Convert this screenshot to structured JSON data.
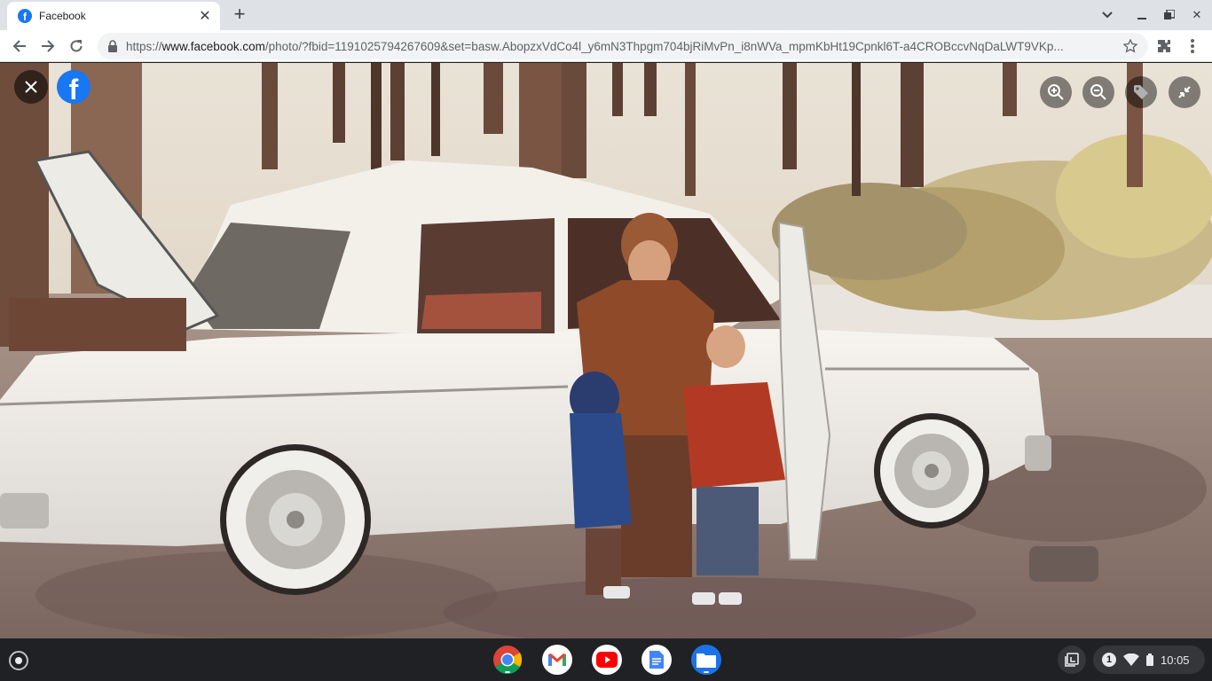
{
  "browser": {
    "tab": {
      "title": "Facebook",
      "favicon_letter": "f"
    },
    "url": {
      "scheme": "https://",
      "host": "www.facebook.com",
      "path": "/photo/?fbid=1191025794267609&set=basw.AbopzxVdCo4l_y6mN3Thpgm704bjRiMvPn_i8nWVa_mpmKbHt19Cpnkl6T-a4CROBccvNqDaLWT9VKp..."
    }
  },
  "viewer": {
    "brand_letter": "f",
    "colors": {
      "brand": "#1877f2"
    }
  },
  "shelf": {
    "apps": [
      "chrome",
      "gmail",
      "youtube",
      "docs",
      "files"
    ],
    "tray": {
      "notification_count": "1",
      "time": "10:05"
    }
  }
}
